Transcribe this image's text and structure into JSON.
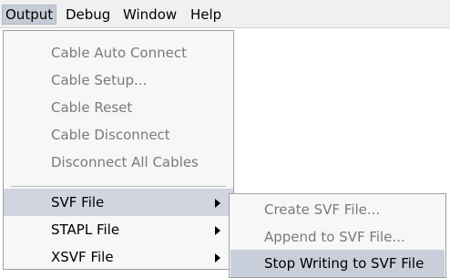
{
  "menubar": {
    "items": [
      {
        "label": "Output",
        "active": true
      },
      {
        "label": "Debug",
        "active": false
      },
      {
        "label": "Window",
        "active": false
      },
      {
        "label": "Help",
        "active": false
      }
    ]
  },
  "output_menu": {
    "items": [
      {
        "label": "Cable Auto Connect",
        "enabled": false
      },
      {
        "label": "Cable Setup...",
        "enabled": false
      },
      {
        "label": "Cable Reset",
        "enabled": false
      },
      {
        "label": "Cable Disconnect",
        "enabled": false
      },
      {
        "label": "Disconnect All Cables",
        "enabled": false
      },
      {
        "label": "SVF File",
        "enabled": true,
        "submenu": true,
        "highlighted": true
      },
      {
        "label": "STAPL File",
        "enabled": true,
        "submenu": true
      },
      {
        "label": "XSVF File",
        "enabled": true,
        "submenu": true
      }
    ]
  },
  "svf_submenu": {
    "items": [
      {
        "label": "Create SVF File...",
        "enabled": false
      },
      {
        "label": "Append to SVF File...",
        "enabled": false
      },
      {
        "label": "Stop Writing to SVF File",
        "enabled": true,
        "highlighted": true
      }
    ]
  }
}
